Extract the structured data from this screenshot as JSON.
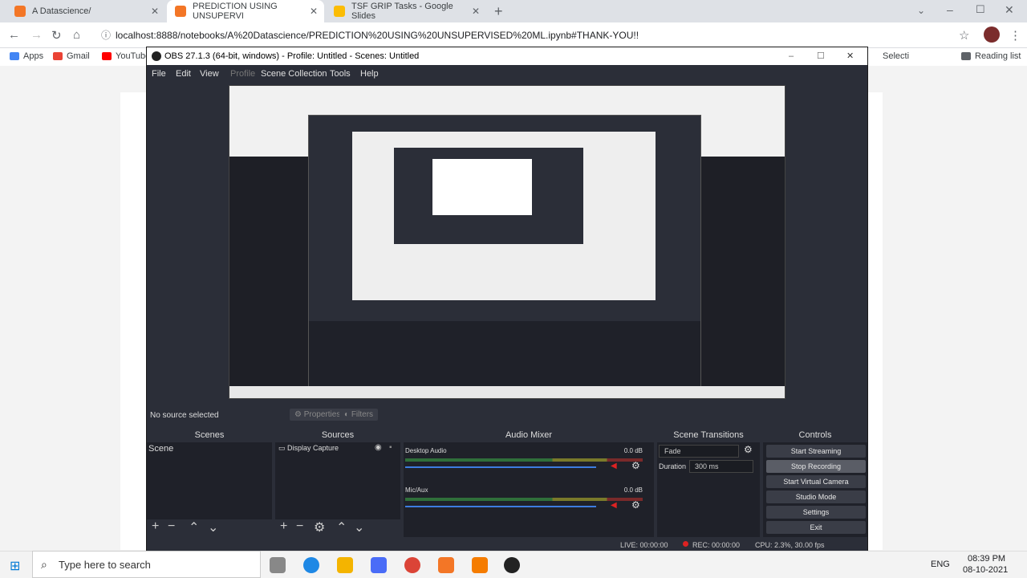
{
  "browser": {
    "tabs": [
      {
        "title": "A Datascience/",
        "active": false,
        "color": "#f37626"
      },
      {
        "title": "PREDICTION USING UNSUPERVI",
        "active": true,
        "color": "#f37626"
      },
      {
        "title": "TSF GRIP Tasks - Google Slides",
        "active": false,
        "color": "#fbbc04"
      }
    ],
    "url": "localhost:8888/notebooks/A%20Datascience/PREDICTION%20USING%20UNSUPERVISED%20ML.ipynb#THANK-YOU!!",
    "bookmarks": [
      "Apps",
      "Gmail",
      "YouTube"
    ],
    "right_bookmark": "Reading list",
    "select_text": "Selecti"
  },
  "obs": {
    "title": "OBS 27.1.3 (64-bit, windows) - Profile: Untitled - Scenes: Untitled",
    "menu": [
      "File",
      "Edit",
      "View",
      "Profile",
      "Scene Collection",
      "Tools",
      "Help"
    ],
    "no_source": "No source selected",
    "properties": "Properties",
    "filters": "Filters",
    "docks": {
      "scenes": "Scenes",
      "sources": "Sources",
      "mixer": "Audio Mixer",
      "transitions": "Scene Transitions",
      "controls": "Controls"
    },
    "scene_item": "Scene",
    "source_item": "Display Capture",
    "audio": [
      {
        "name": "Desktop Audio",
        "db": "0.0 dB",
        "level": 0.8
      },
      {
        "name": "Mic/Aux",
        "db": "0.0 dB",
        "level": 0.75
      }
    ],
    "transition": "Fade",
    "duration_label": "Duration",
    "duration_value": "300 ms",
    "controls": [
      "Start Streaming",
      "Stop Recording",
      "Start Virtual Camera",
      "Studio Mode",
      "Settings",
      "Exit"
    ],
    "status": {
      "live": "LIVE: 00:00:00",
      "rec": "REC: 00:00:00",
      "cpu": "CPU: 2.3%, 30.00 fps"
    }
  },
  "taskbar": {
    "search": "Type here to search",
    "lang": "ENG",
    "time": "08:39 PM",
    "date": "08-10-2021"
  }
}
